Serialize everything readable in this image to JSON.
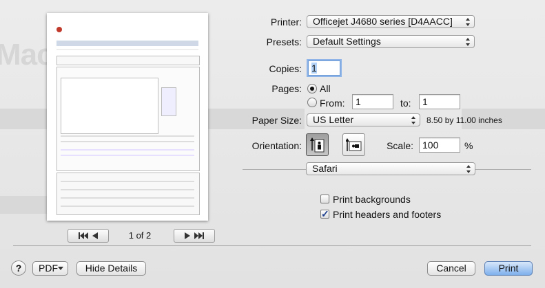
{
  "printer": {
    "label": "Printer:",
    "value": "Officejet J4680 series [D4AACC]"
  },
  "presets": {
    "label": "Presets:",
    "value": "Default Settings"
  },
  "copies": {
    "label": "Copies:",
    "value": "1"
  },
  "pages": {
    "label": "Pages:",
    "all_label": "All",
    "from_label": "From:",
    "from_value": "1",
    "to_label": "to:",
    "to_value": "1",
    "selected": "All"
  },
  "paper_size": {
    "label": "Paper Size:",
    "value": "US Letter",
    "dimensions": "8.50 by 11.00 inches"
  },
  "orientation": {
    "label": "Orientation:",
    "selected": "portrait"
  },
  "scale": {
    "label": "Scale:",
    "value": "100",
    "unit": "%"
  },
  "section": {
    "value": "Safari"
  },
  "options": [
    {
      "label": "Print backgrounds",
      "checked": false
    },
    {
      "label": "Print headers and footers",
      "checked": true
    }
  ],
  "pager": {
    "label": "1 of 2"
  },
  "footer": {
    "help_label": "?",
    "pdf_label": "PDF",
    "hide_details_label": "Hide Details",
    "cancel_label": "Cancel",
    "print_label": "Print"
  },
  "colors": {
    "accent": "#7fb0ec",
    "sheet_bg": "#e6e6e6"
  }
}
